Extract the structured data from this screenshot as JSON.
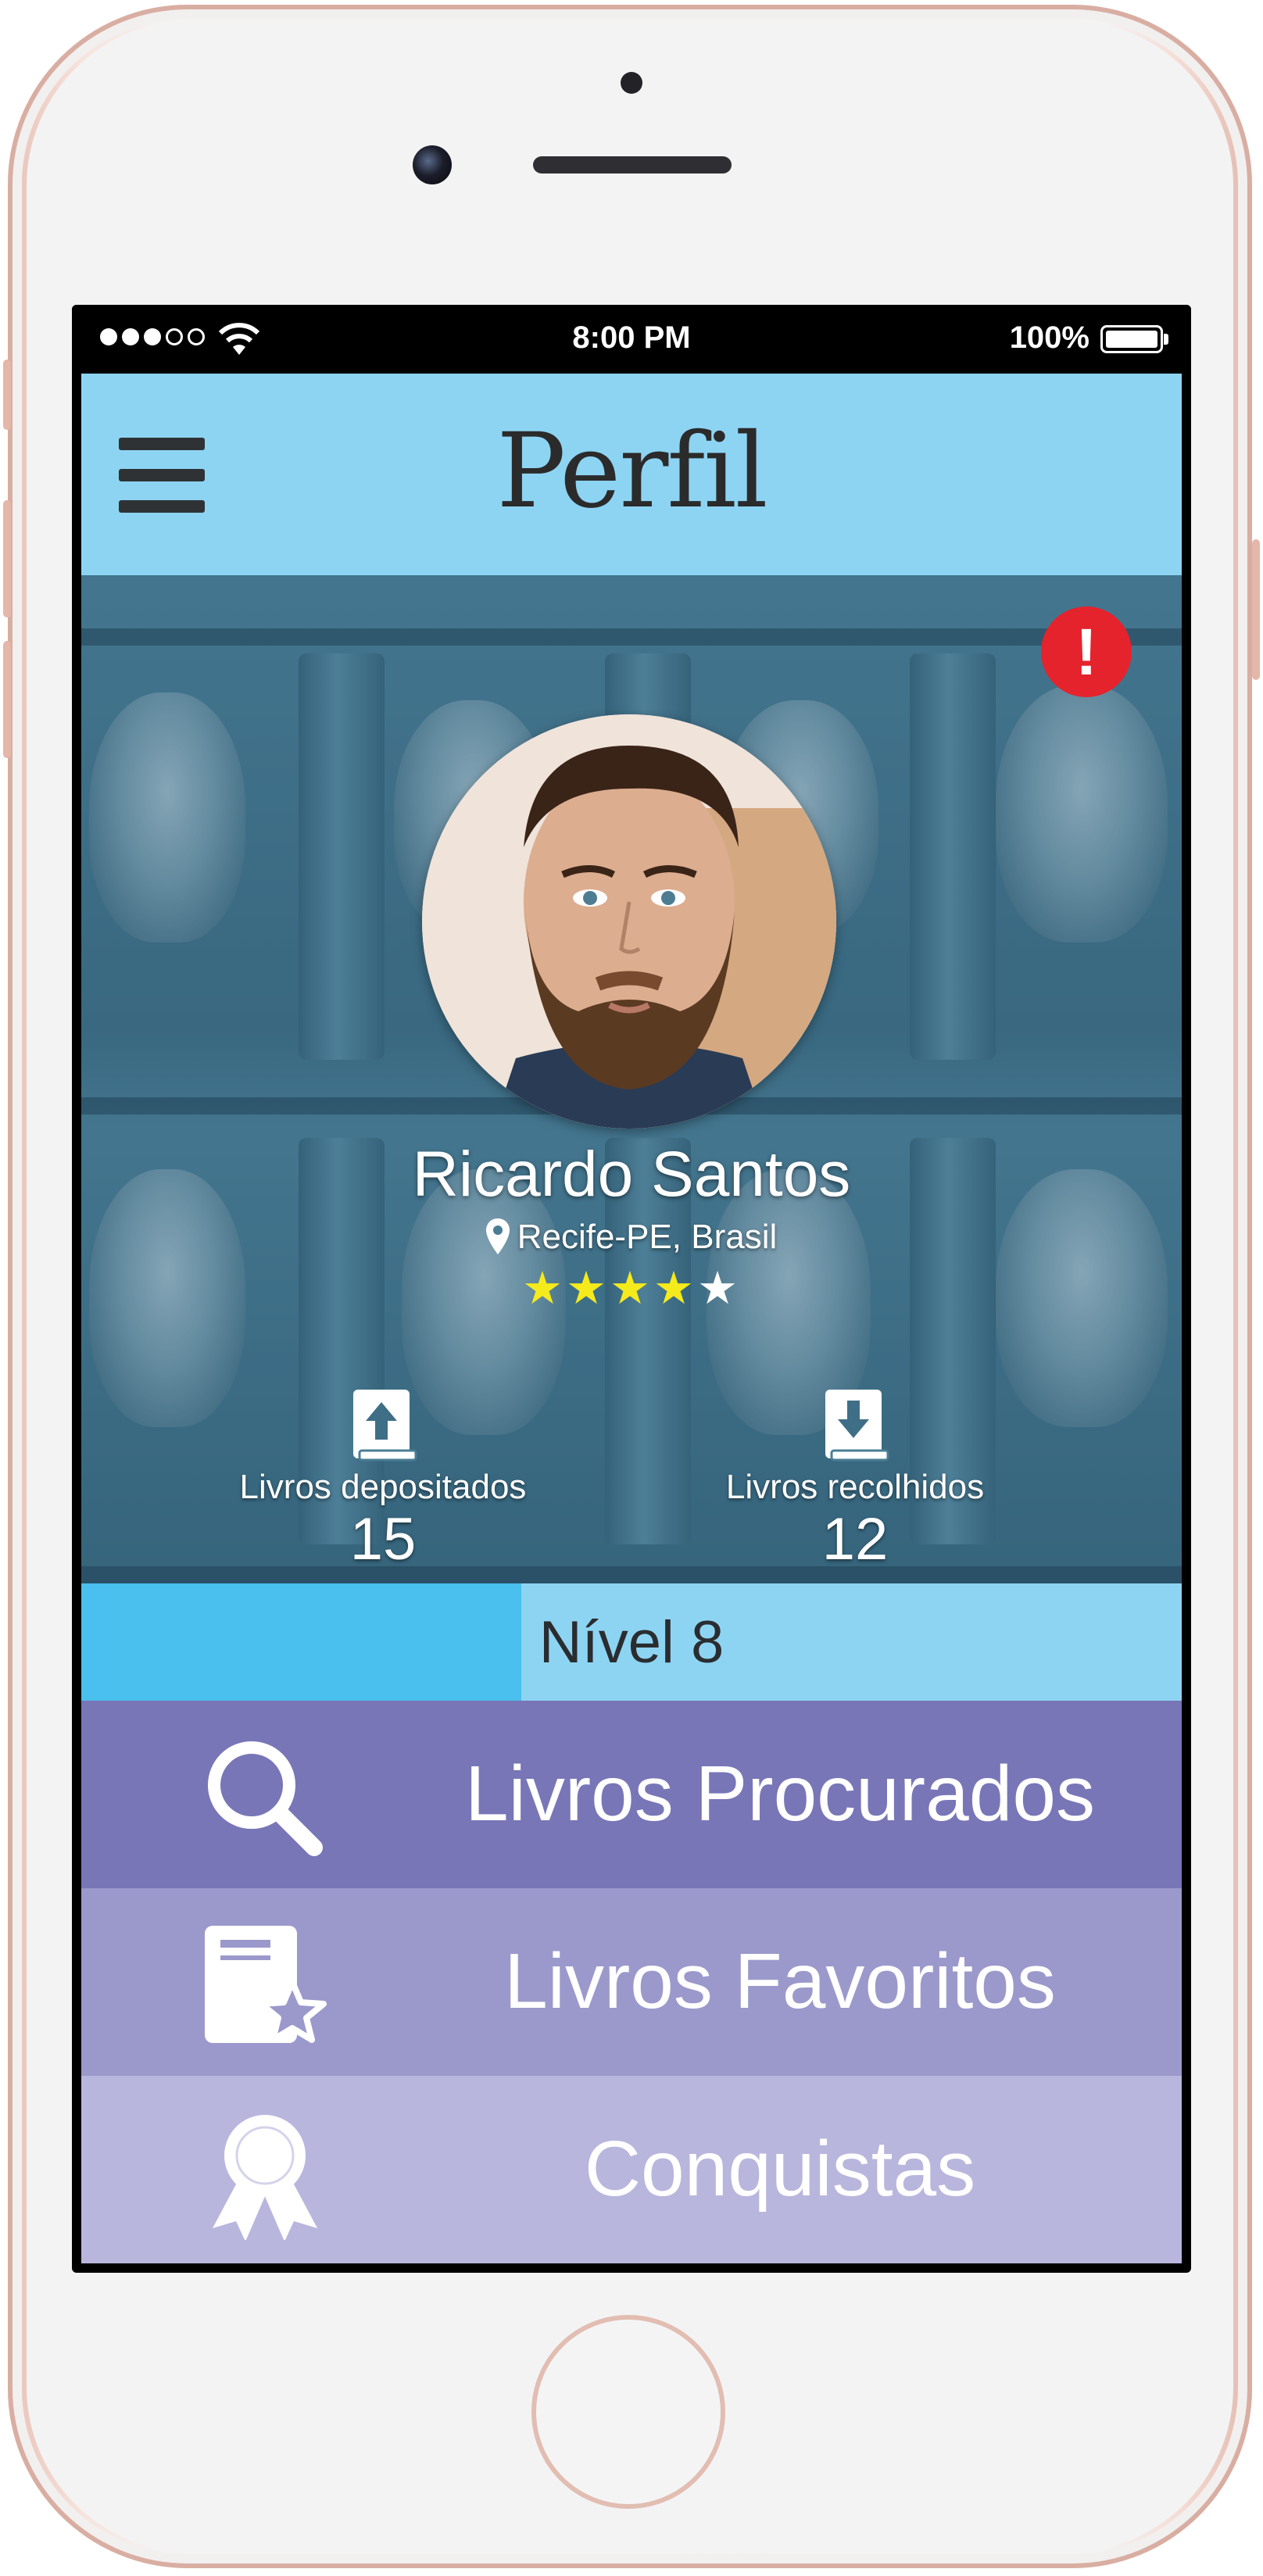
{
  "status_bar": {
    "time": "8:00 PM",
    "battery": "100%"
  },
  "header": {
    "title": "Perfil"
  },
  "profile": {
    "name": "Ricardo Santos",
    "location": "Recife-PE, Brasil",
    "rating": 4,
    "rating_max": 5,
    "alert_symbol": "!"
  },
  "stats": {
    "deposited_label": "Livros depositados",
    "deposited_value": "15",
    "collected_label": "Livros recolhidos",
    "collected_value": "12"
  },
  "level": {
    "label": "Nível 8",
    "progress": 0.4
  },
  "menu": [
    {
      "label": "Livros Procurados",
      "icon": "search-icon"
    },
    {
      "label": "Livros Favoritos",
      "icon": "favorite-book-icon"
    },
    {
      "label": "Conquistas",
      "icon": "award-ribbon-icon"
    }
  ],
  "colors": {
    "topbar": "#8dd4f3",
    "level_fill": "#49c0ed",
    "alert": "#e5232c",
    "star_on": "#f5ea1c",
    "menu_row_1": "#7876b7",
    "menu_row_2": "#9b99cb",
    "menu_row_3": "#b8b6dd"
  }
}
